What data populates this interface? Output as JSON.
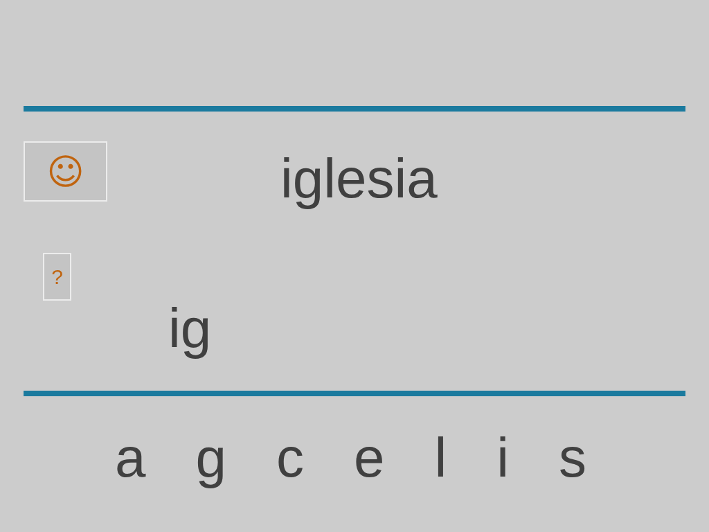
{
  "smiley_button": {
    "label": "☺"
  },
  "target_word": "iglesia",
  "hint_button": {
    "label": "?"
  },
  "answer": "ig",
  "letters": [
    "a",
    "g",
    "c",
    "e",
    "l",
    "i",
    "s"
  ]
}
